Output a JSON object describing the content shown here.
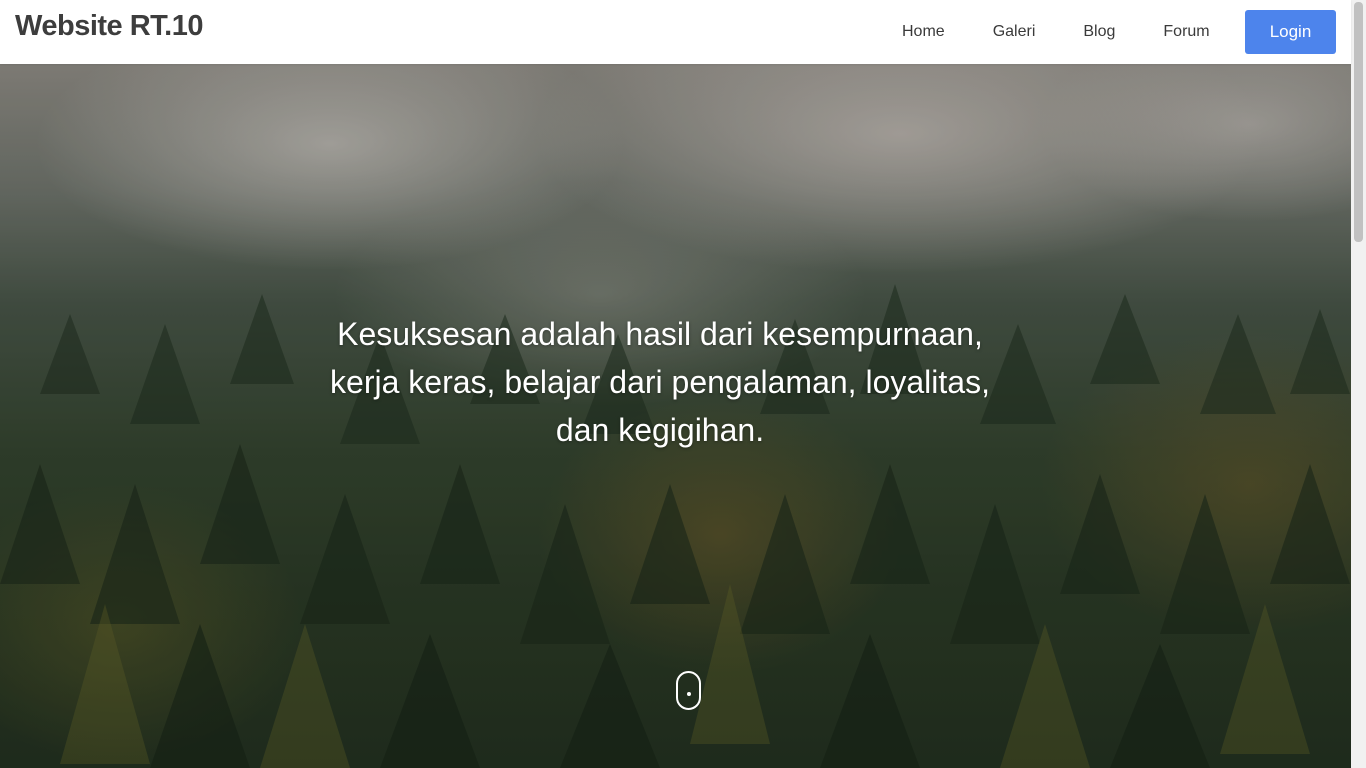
{
  "navbar": {
    "brand": "Website RT.10",
    "links": [
      "Home",
      "Galeri",
      "Blog",
      "Forum"
    ],
    "login_label": "Login",
    "login_color": "#4d84ec"
  },
  "hero": {
    "quote": "Kesuksesan adalah hasil dari kesempurnaan, kerja keras, belajar dari pengalaman, loyalitas, dan kegigihan.",
    "background": "misty-forest-photo",
    "scroll_indicator_icon": "mouse-scroll-icon"
  }
}
